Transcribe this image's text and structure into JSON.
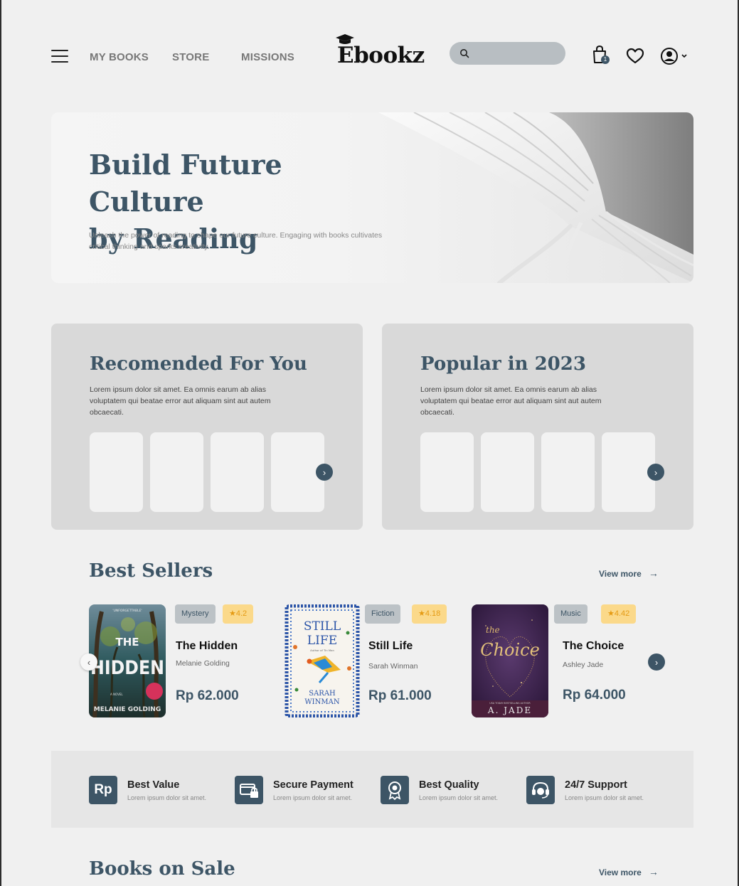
{
  "nav": {
    "links": [
      "MY BOOKS",
      "STORE",
      "MISSIONS"
    ],
    "logo": "Ebookz",
    "search_placeholder": "",
    "cart_count": "1"
  },
  "hero": {
    "title_line1": "Build Future Culture",
    "title_line2": "by Reading",
    "subtitle": "Unleash the power of reading to shape our future culture. Engaging with books cultivates critical thinking and sparks creativity."
  },
  "panels": [
    {
      "title": "Recomended For You",
      "desc": "Lorem ipsum dolor sit amet. Ea omnis earum ab alias voluptatem qui beatae error aut aliquam sint aut autem obcaecati."
    },
    {
      "title": "Popular in 2023",
      "desc": "Lorem ipsum dolor sit amet. Ea omnis earum ab alias voluptatem qui beatae error aut aliquam sint aut autem obcaecati."
    }
  ],
  "best_sellers": {
    "title": "Best Sellers",
    "view_more": "View more",
    "books": [
      {
        "category": "Mystery",
        "rating": "4.2",
        "title": "The Hidden",
        "author": "Melanie Golding",
        "price": "Rp 62.000",
        "cover_line1": "THE",
        "cover_line2": "HIDDEN",
        "cover_author": "MELANIE GOLDING",
        "cover_top": "'UNFORGETTABLE'",
        "cover_series": "A NOVEL"
      },
      {
        "category": "Fiction",
        "rating": "4.18",
        "title": "Still Life",
        "author": "Sarah Winman",
        "price": "Rp 61.000",
        "cover_line1": "STILL",
        "cover_line2": "LIFE",
        "cover_author_1": "SARAH",
        "cover_author_2": "WINMAN",
        "cover_note": "Author of Tin Man"
      },
      {
        "category": "Music",
        "rating": "4.42",
        "title": "The Choice",
        "author": "Ashley Jade",
        "price": "Rp 64.000",
        "cover_line1": "the",
        "cover_line2": "Choice",
        "cover_author": "A. JADE",
        "cover_note": "USA TODAY BESTSELLING AUTHOR"
      }
    ]
  },
  "features": [
    {
      "title": "Best Value",
      "desc": "Lorem ipsum dolor sit amet.",
      "icon_text": "Rp"
    },
    {
      "title": "Secure Payment",
      "desc": "Lorem ipsum dolor sit amet."
    },
    {
      "title": "Best Quality",
      "desc": "Lorem ipsum dolor sit amet."
    },
    {
      "title": "24/7 Support",
      "desc": "Lorem ipsum dolor sit amet."
    }
  ],
  "books_on_sale": {
    "title": "Books on Sale",
    "view_more": "View more"
  },
  "colors": {
    "primary": "#3d5566",
    "background": "#f0f0f0",
    "panel": "#d9d9d9",
    "rating_bg": "#fbd98a",
    "rating_text": "#e59b14"
  }
}
